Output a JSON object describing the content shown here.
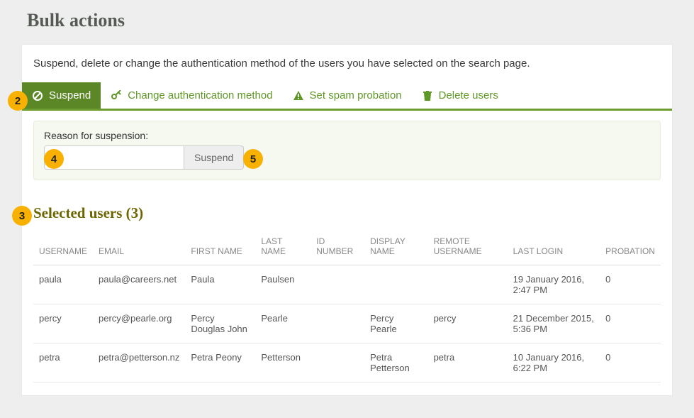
{
  "page_title": "Bulk actions",
  "intro": "Suspend, delete or change the authentication method of the users you have selected on the search page.",
  "tabs": {
    "suspend": "Suspend",
    "change_auth": "Change authentication method",
    "spam": "Set spam probation",
    "delete": "Delete users"
  },
  "suspend_panel": {
    "label": "Reason for suspension:",
    "reason_value": "",
    "button": "Suspend"
  },
  "selected_heading": "Selected users (3)",
  "columns": {
    "username": "USERNAME",
    "email": "EMAIL",
    "first_name": "FIRST NAME",
    "last_name": "LAST NAME",
    "id_number": "ID NUMBER",
    "display_name": "DISPLAY NAME",
    "remote_username": "REMOTE USERNAME",
    "last_login": "LAST LOGIN",
    "probation": "PROBATION"
  },
  "rows": [
    {
      "username": "paula",
      "email": "paula@careers.net",
      "first_name": "Paula",
      "last_name": "Paulsen",
      "id_number": "",
      "display_name": "",
      "remote_username": "",
      "last_login": "19 January 2016, 2:47 PM",
      "probation": "0"
    },
    {
      "username": "percy",
      "email": "percy@pearle.org",
      "first_name": "Percy Douglas John",
      "last_name": "Pearle",
      "id_number": "",
      "display_name": "Percy Pearle",
      "remote_username": "percy",
      "last_login": "21 December 2015, 5:36 PM",
      "probation": "0"
    },
    {
      "username": "petra",
      "email": "petra@petterson.nz",
      "first_name": "Petra Peony",
      "last_name": "Petterson",
      "id_number": "",
      "display_name": "Petra Petterson",
      "remote_username": "petra",
      "last_login": "10 January 2016, 6:22 PM",
      "probation": "0"
    }
  ],
  "badges": {
    "b2": "2",
    "b3": "3",
    "b4": "4",
    "b5": "5"
  }
}
